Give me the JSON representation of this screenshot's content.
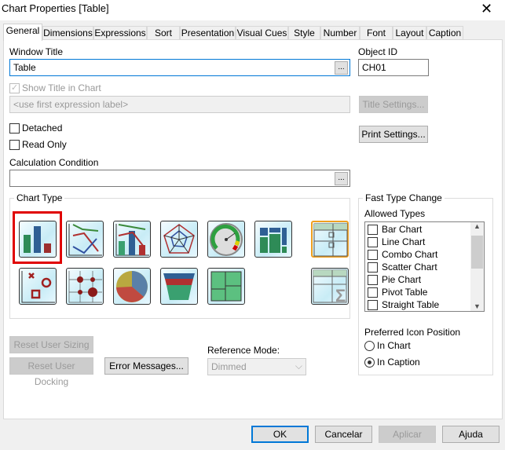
{
  "window": {
    "title": "Chart Properties [Table]"
  },
  "tabs": [
    "General",
    "Dimensions",
    "Expressions",
    "Sort",
    "Presentation",
    "Visual Cues",
    "Style",
    "Number",
    "Font",
    "Layout",
    "Caption"
  ],
  "general": {
    "window_title_label": "Window Title",
    "window_title_value": "Table",
    "ellipsis": "...",
    "object_id_label": "Object ID",
    "object_id_value": "CH01",
    "show_title_label": "Show Title in Chart",
    "title_placeholder": "<use first expression label>",
    "title_settings": "Title Settings...",
    "print_settings": "Print Settings...",
    "detached_label": "Detached",
    "read_only_label": "Read Only",
    "calc_condition_label": "Calculation Condition",
    "chart_type_label": "Chart Type",
    "chart_types": [
      "bar-chart",
      "line-chart",
      "combo-chart",
      "radar-chart",
      "gauge-chart",
      "mekko-chart",
      "pivot-table",
      "scatter-chart",
      "grid-chart",
      "pie-chart",
      "funnel-chart",
      "block-chart",
      "straight-table"
    ],
    "selected_chart_type": "bar-chart",
    "fast_type_label": "Fast Type Change",
    "allowed_types_label": "Allowed Types",
    "allowed_types": [
      "Bar Chart",
      "Line Chart",
      "Combo Chart",
      "Scatter Chart",
      "Pie Chart",
      "Pivot Table",
      "Straight Table"
    ],
    "icon_position_label": "Preferred Icon Position",
    "icon_position_options": [
      "In Chart",
      "In Caption"
    ],
    "icon_position_selected": "In Caption",
    "reset_sizing": "Reset User Sizing",
    "reset_docking": "Reset User Docking",
    "error_messages": "Error Messages...",
    "reference_mode_label": "Reference Mode:",
    "reference_mode_value": "Dimmed"
  },
  "footer": {
    "ok": "OK",
    "cancel": "Cancelar",
    "apply": "Aplicar",
    "help": "Ajuda"
  },
  "colors": {
    "selection": "#e00000",
    "ok_border": "#0078d7"
  }
}
